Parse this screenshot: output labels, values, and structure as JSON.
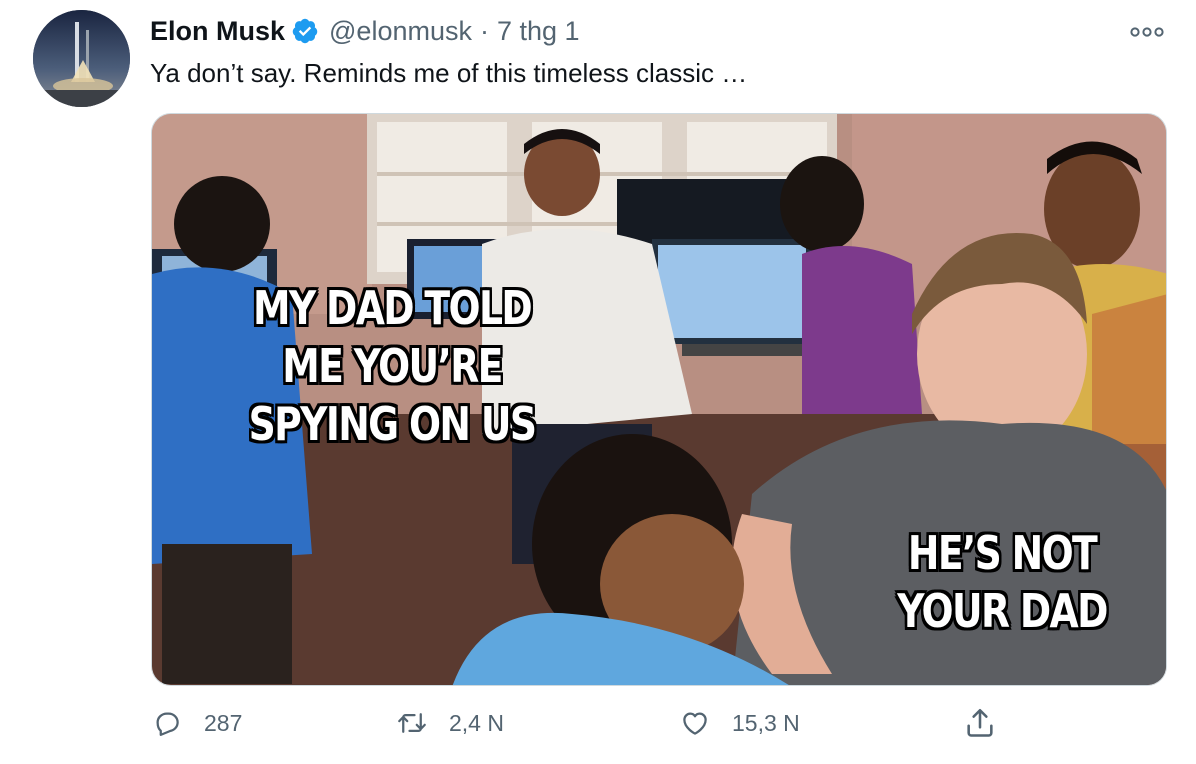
{
  "tweet": {
    "author_name": "Elon Musk",
    "handle": "@elonmusk",
    "separator": "·",
    "timestamp": "7 thg 1",
    "text": "Ya don’t say. Reminds me of this timeless classic …"
  },
  "media": {
    "caption_top": "MY DAD TOLD\nME YOU’RE\nSPYING ON US",
    "caption_bottom": "HE’S NOT\nYOUR DAD"
  },
  "actions": {
    "reply_count": "287",
    "retweet_count": "2,4 N",
    "like_count": "15,3 N"
  },
  "icons": {
    "verified": "verified-badge-icon",
    "more": "more-options-icon",
    "reply": "reply-icon",
    "retweet": "retweet-icon",
    "like": "heart-icon",
    "share": "share-icon"
  },
  "colors": {
    "verified_blue": "#1d9bf0",
    "secondary_text": "#536471",
    "primary_text": "#0f1419"
  }
}
